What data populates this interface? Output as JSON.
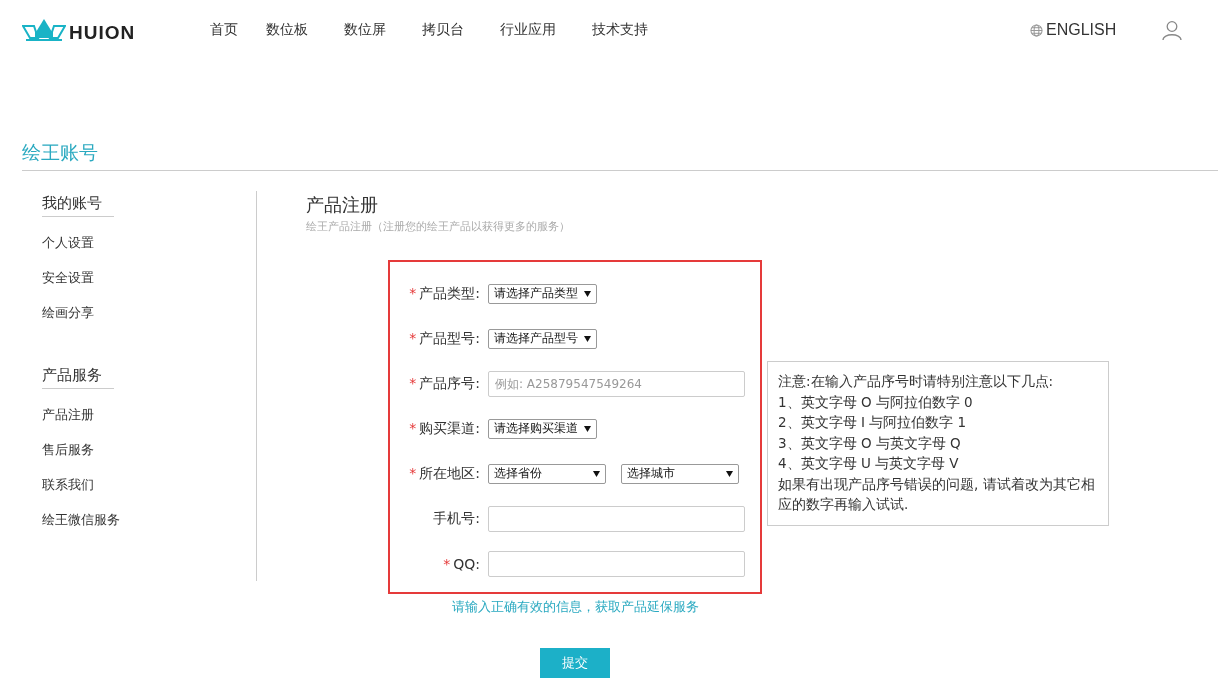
{
  "header": {
    "logo_text": "HUION",
    "nav": [
      "首页",
      "数位板",
      "数位屏",
      "拷贝台",
      "行业应用",
      "技术支持"
    ],
    "language": "ENGLISH"
  },
  "page_title": "绘王账号",
  "sidebar": [
    {
      "heading": "我的账号",
      "items": [
        "个人设置",
        "安全设置",
        "绘画分享"
      ]
    },
    {
      "heading": "产品服务",
      "items": [
        "产品注册",
        "售后服务",
        "联系我们",
        "绘王微信服务"
      ]
    }
  ],
  "form": {
    "title": "产品注册",
    "subtitle": "绘王产品注册（注册您的绘王产品以获得更多的服务）",
    "fields": [
      {
        "required_mark": "*",
        "label": "产品类型:",
        "controls": [
          {
            "kind": "select",
            "value": "请选择产品类型"
          }
        ]
      },
      {
        "required_mark": "*",
        "label": "产品型号:",
        "controls": [
          {
            "kind": "select",
            "value": "请选择产品型号"
          }
        ]
      },
      {
        "required_mark": "*",
        "label": "产品序号:",
        "controls": [
          {
            "kind": "input",
            "placeholder": "例如: A25879547549264"
          }
        ]
      },
      {
        "required_mark": "*",
        "label": "购买渠道:",
        "controls": [
          {
            "kind": "select",
            "value": "请选择购买渠道"
          }
        ]
      },
      {
        "required_mark": "*",
        "label": "所在地区:",
        "controls": [
          {
            "kind": "select",
            "value": "选择省份"
          },
          {
            "kind": "select",
            "value": "选择城市"
          }
        ]
      },
      {
        "label": "手机号:",
        "controls": [
          {
            "kind": "input"
          }
        ]
      },
      {
        "required_mark": "*",
        "label": "QQ:",
        "controls": [
          {
            "kind": "input"
          }
        ]
      }
    ],
    "hint": "请输入正确有效的信息，获取产品延保服务",
    "submit": "提交"
  },
  "note": [
    "注意:在输入产品序号时请特别注意以下几点:",
    "1、英文字母 O 与阿拉伯数字 0",
    "2、英文字母 I 与阿拉伯数字 1",
    "3、英文字母 O 与英文字母 Q",
    "4、英文字母 U 与英文字母 V",
    "如果有出现产品序号错误的问题, 请试着改为其它相应的数字再输入试试."
  ]
}
